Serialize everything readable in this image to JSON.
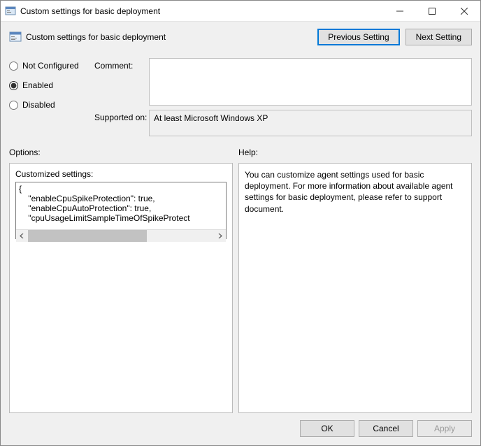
{
  "window": {
    "title": "Custom settings for basic deployment"
  },
  "header": {
    "title": "Custom settings for basic deployment",
    "prev_btn": "Previous Setting",
    "next_btn": "Next Setting"
  },
  "state": {
    "radios": {
      "not_configured": "Not Configured",
      "enabled": "Enabled",
      "disabled": "Disabled",
      "selected": "enabled"
    },
    "comment_label": "Comment:",
    "comment_value": "",
    "supported_label": "Supported on:",
    "supported_value": "At least Microsoft Windows XP"
  },
  "sections": {
    "options_label": "Options:",
    "help_label": "Help:"
  },
  "options": {
    "customized_label": "Customized settings:",
    "customized_value": "{\n    \"enableCpuSpikeProtection\": true,\n    \"enableCpuAutoProtection\": true,\n    \"cpuUsageLimitSampleTimeOfSpikeProtect"
  },
  "help": {
    "text": "You can customize agent settings used for basic deployment. For more information about available agent settings for basic deployment, please refer to support document."
  },
  "footer": {
    "ok": "OK",
    "cancel": "Cancel",
    "apply": "Apply"
  }
}
